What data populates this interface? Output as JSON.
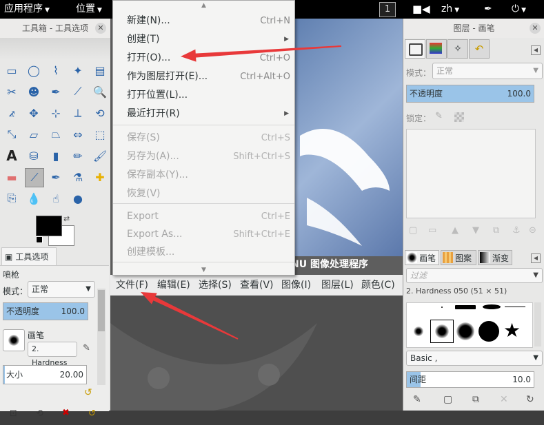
{
  "topbar": {
    "applications": "应用程序",
    "places": "位置",
    "workspace": "1",
    "input_method": "zh",
    "icons": [
      "video-camera-icon",
      "pen-icon",
      "power-icon"
    ]
  },
  "toolbox": {
    "title": "工具箱 - 工具选项",
    "tool_options_tab": "工具选项",
    "tool_name": "喷枪",
    "mode_label": "模式：",
    "mode_value": "正常",
    "opacity_label": "不透明度",
    "opacity_value": "100.0",
    "opacity_fraction": 1.0,
    "brush_label": "画笔",
    "brush_value": "2. Hardness",
    "size_label": "大小",
    "size_value": "20.00"
  },
  "canvas": {
    "title_fragment": "NU 图像处理程序",
    "menubar": [
      "文件(F)",
      "编辑(E)",
      "选择(S)",
      "查看(V)",
      "图像(I)",
      "图层(L)",
      "颜色(C)"
    ]
  },
  "file_menu": {
    "items": [
      {
        "label": "新建(N)...",
        "accel": "Ctrl+N",
        "enabled": true,
        "submenu": false
      },
      {
        "label": "创建(T)",
        "accel": "",
        "enabled": true,
        "submenu": true
      },
      {
        "label": "打开(O)...",
        "accel": "Ctrl+O",
        "enabled": true,
        "submenu": false
      },
      {
        "label": "作为图层打开(E)...",
        "accel": "Ctrl+Alt+O",
        "enabled": true,
        "submenu": false
      },
      {
        "label": "打开位置(L)...",
        "accel": "",
        "enabled": true,
        "submenu": false
      },
      {
        "label": "最近打开(R)",
        "accel": "",
        "enabled": true,
        "submenu": true
      },
      {
        "label": "保存(S)",
        "accel": "Ctrl+S",
        "enabled": false,
        "submenu": false
      },
      {
        "label": "另存为(A)...",
        "accel": "Shift+Ctrl+S",
        "enabled": false,
        "submenu": false
      },
      {
        "label": "保存副本(Y)...",
        "accel": "",
        "enabled": false,
        "submenu": false
      },
      {
        "label": "恢复(V)",
        "accel": "",
        "enabled": false,
        "submenu": false
      },
      {
        "label": "Export",
        "accel": "Ctrl+E",
        "enabled": false,
        "submenu": false
      },
      {
        "label": "Export As...",
        "accel": "Shift+Ctrl+E",
        "enabled": false,
        "submenu": false
      },
      {
        "label": "创建模板...",
        "accel": "",
        "enabled": false,
        "submenu": false
      }
    ]
  },
  "right_panel": {
    "title": "图层 - 画笔",
    "mode_label": "模式：",
    "mode_value": "正常",
    "opacity_label": "不透明度",
    "opacity_value": "100.0",
    "opacity_fraction": 1.0,
    "lock_label": "锁定：",
    "brush_tabs": [
      "画笔",
      "图案",
      "渐变"
    ],
    "filter_placeholder": "过滤",
    "brush_name": "2. Hardness 050 (51 × 51)",
    "tag_value": "Basic ,",
    "spacing_label": "间距",
    "spacing_value": "10.0"
  },
  "colors": {
    "foreground": "#000000",
    "background": "#ffffff",
    "accent": "#9ac4e8",
    "arrow": "#e8393a"
  }
}
